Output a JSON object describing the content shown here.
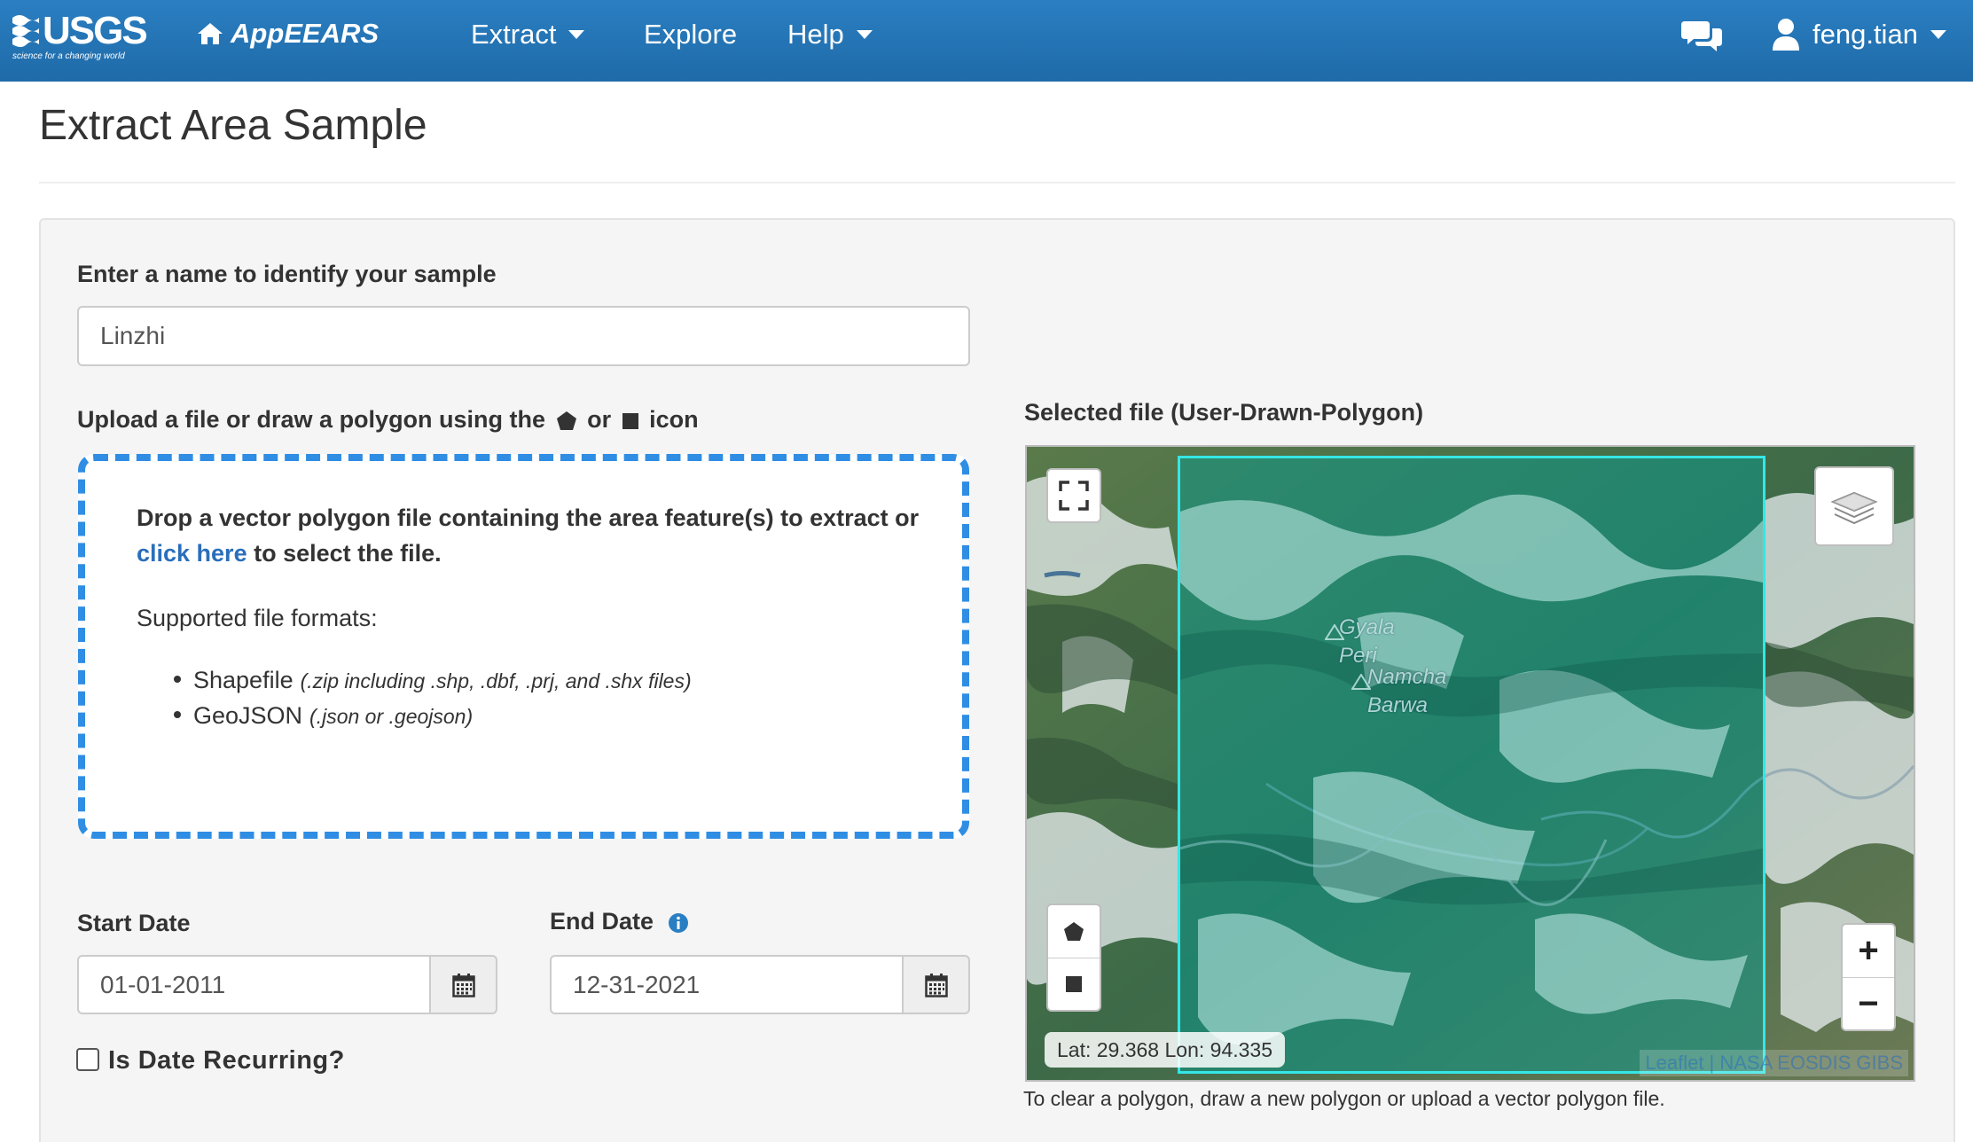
{
  "navbar": {
    "logo_text": "USGS",
    "logo_tagline": "science for a changing world",
    "brand": "AppEEARS",
    "items": [
      {
        "label": "Extract"
      },
      {
        "label": "Explore"
      },
      {
        "label": "Help"
      }
    ],
    "username": "feng.tian",
    "icons": [
      "home-icon",
      "chat-icon",
      "user-icon"
    ]
  },
  "page": {
    "title": "Extract Area Sample"
  },
  "form": {
    "name_label": "Enter a name to identify your sample",
    "name_value": "Linzhi",
    "upload_label_prefix": "Upload a file or draw a polygon using the",
    "upload_label_or": "or",
    "upload_label_suffix": "icon",
    "dropzone": {
      "main_before": "Drop a vector polygon file containing the area feature(s) to extract or",
      "link": "click here",
      "main_after": "to select the file.",
      "supported_label": "Supported file formats:",
      "formats": [
        {
          "name": "Shapefile",
          "note": "(.zip including .shp, .dbf, .prj, and .shx files)"
        },
        {
          "name": "GeoJSON",
          "note": "(.json or .geojson)"
        }
      ]
    },
    "start_date_label": "Start Date",
    "start_date_value": "01-01-2011",
    "end_date_label": "End Date",
    "end_date_value": "12-31-2021",
    "recurring_label": "Is Date Recurring?",
    "recurring_checked": false
  },
  "map": {
    "selected_file_label": "Selected file (User-Drawn-Polygon)",
    "place_labels": [
      {
        "text": "Gyala\nPeri"
      },
      {
        "text": "Namcha\nBarwa"
      }
    ],
    "coords": "Lat: 29.368 Lon: 94.335",
    "attribution": "Leaflet | NASA EOSDIS GIBS",
    "zoom_in": "+",
    "zoom_out": "−",
    "caption": "To clear a polygon, draw a new polygon or upload a vector polygon file.",
    "polygon_color": "#35e6e6"
  },
  "colors": {
    "navbar": "#2a7fc2",
    "link": "#2a6ebb",
    "dropzone_border": "#2f8de4"
  }
}
